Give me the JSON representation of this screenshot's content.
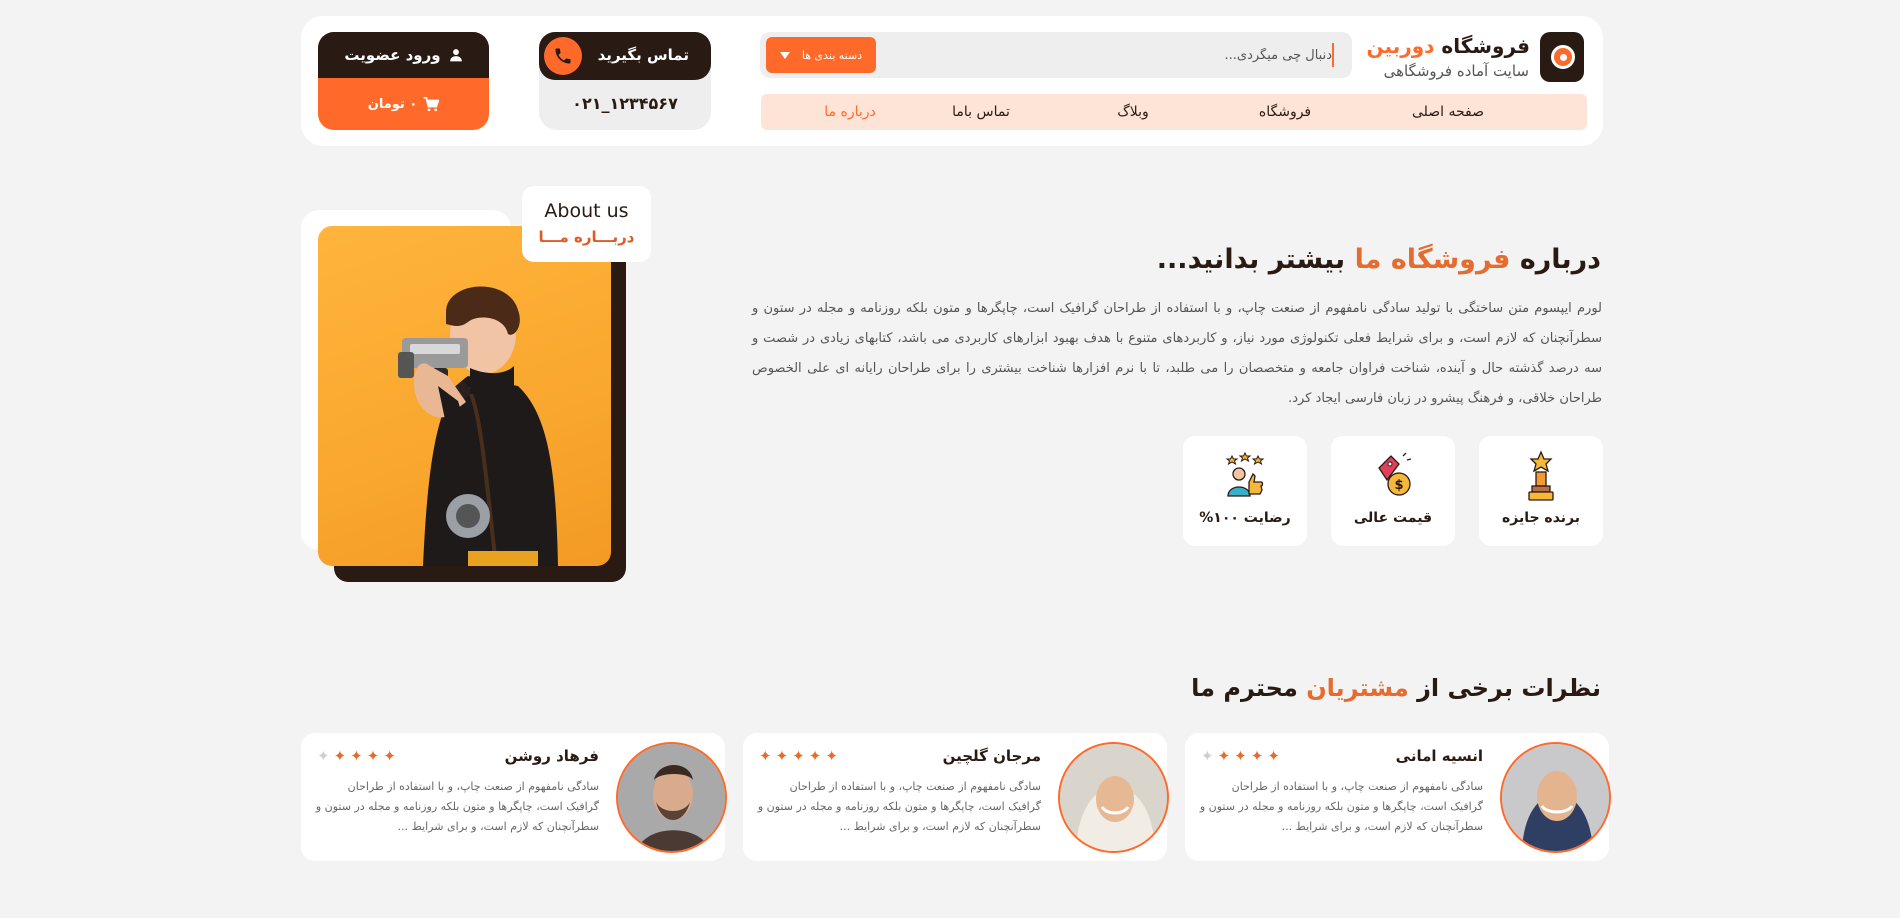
{
  "header": {
    "brand_main": "فروشگاه",
    "brand_accent": "دوربین",
    "tagline": "سایت آماده فروشگاهی",
    "search_placeholder": "دنبال چی میگردی...",
    "categories_label": "دسته بندی ها",
    "contact_label": "تماس بگیرید",
    "phone": "۰۲۱_۱۲۳۴۵۶۷",
    "login_label": "ورود عضویت",
    "cart_label": "۰ تومان"
  },
  "nav": {
    "items": [
      {
        "label": "صفحه اصلی",
        "active": false
      },
      {
        "label": "فروشگاه",
        "active": false
      },
      {
        "label": "وبلاگ",
        "active": false
      },
      {
        "label": "تماس باما",
        "active": false
      },
      {
        "label": "درباره ما",
        "active": true
      }
    ]
  },
  "about": {
    "tag_en": "About us",
    "tag_fa": "دربـــاره مـــا",
    "title_pre": "درباره",
    "title_accent": "فروشگاه ما",
    "title_post": "بیشتر بدانید...",
    "paragraph": "لورم ایپسوم متن ساختگی با تولید سادگی نامفهوم از صنعت چاپ، و با استفاده از طراحان گرافیک است، چاپگرها و متون بلکه روزنامه و مجله در ستون و سطرآنچنان که لازم است، و برای شرایط فعلی تکنولوژی مورد نیاز، و کاربردهای متنوع با هدف بهبود ابزارهای کاربردی می باشد، کتابهای زیادی در شصت و سه درصد گذشته حال و آینده، شناخت فراوان جامعه و متخصصان را می طلبد، تا با نرم افزارها شناخت بیشتری را برای طراحان رایانه ای علی الخصوص طراحان خلاقی، و فرهنگ پیشرو در زبان فارسی ایجاد کرد.",
    "features": [
      {
        "label": "برنده جایزه",
        "icon": "trophy-icon"
      },
      {
        "label": "قیمت عالی",
        "icon": "price-tag-icon"
      },
      {
        "label": "رضایت ۱۰۰%",
        "icon": "satisfaction-icon"
      }
    ]
  },
  "testimonials": {
    "title_pre": "نظرات برخی از",
    "title_accent": "مشتریان",
    "title_post": "محترم ما",
    "items": [
      {
        "name": "انسیه امانی",
        "rating": 4,
        "text": "سادگی نامفهوم از صنعت چاپ، و با استفاده از طراحان گرافیک است، چاپگرها و متون بلکه روزنامه و مجله در ستون و سطرآنچنان که لازم است، و برای شرایط ..."
      },
      {
        "name": "مرجان گلچین",
        "rating": 5,
        "text": "سادگی نامفهوم از صنعت چاپ، و با استفاده از طراحان گرافیک است، چاپگرها و متون بلکه روزنامه و مجله در ستون و سطرآنچنان که لازم است، و برای شرایط ..."
      },
      {
        "name": "فرهاد روشن",
        "rating": 4,
        "text": "سادگی نامفهوم از صنعت چاپ، و با استفاده از طراحان گرافیک است، چاپگرها و متون بلکه روزنامه و مجله در ستون و سطرآنچنان که لازم است، و برای شرایط ..."
      }
    ]
  },
  "colors": {
    "accent": "#ff6a2a",
    "dark": "#2a1a14",
    "nav_bg": "#fde4d6",
    "page_bg": "#f3f3f3"
  }
}
